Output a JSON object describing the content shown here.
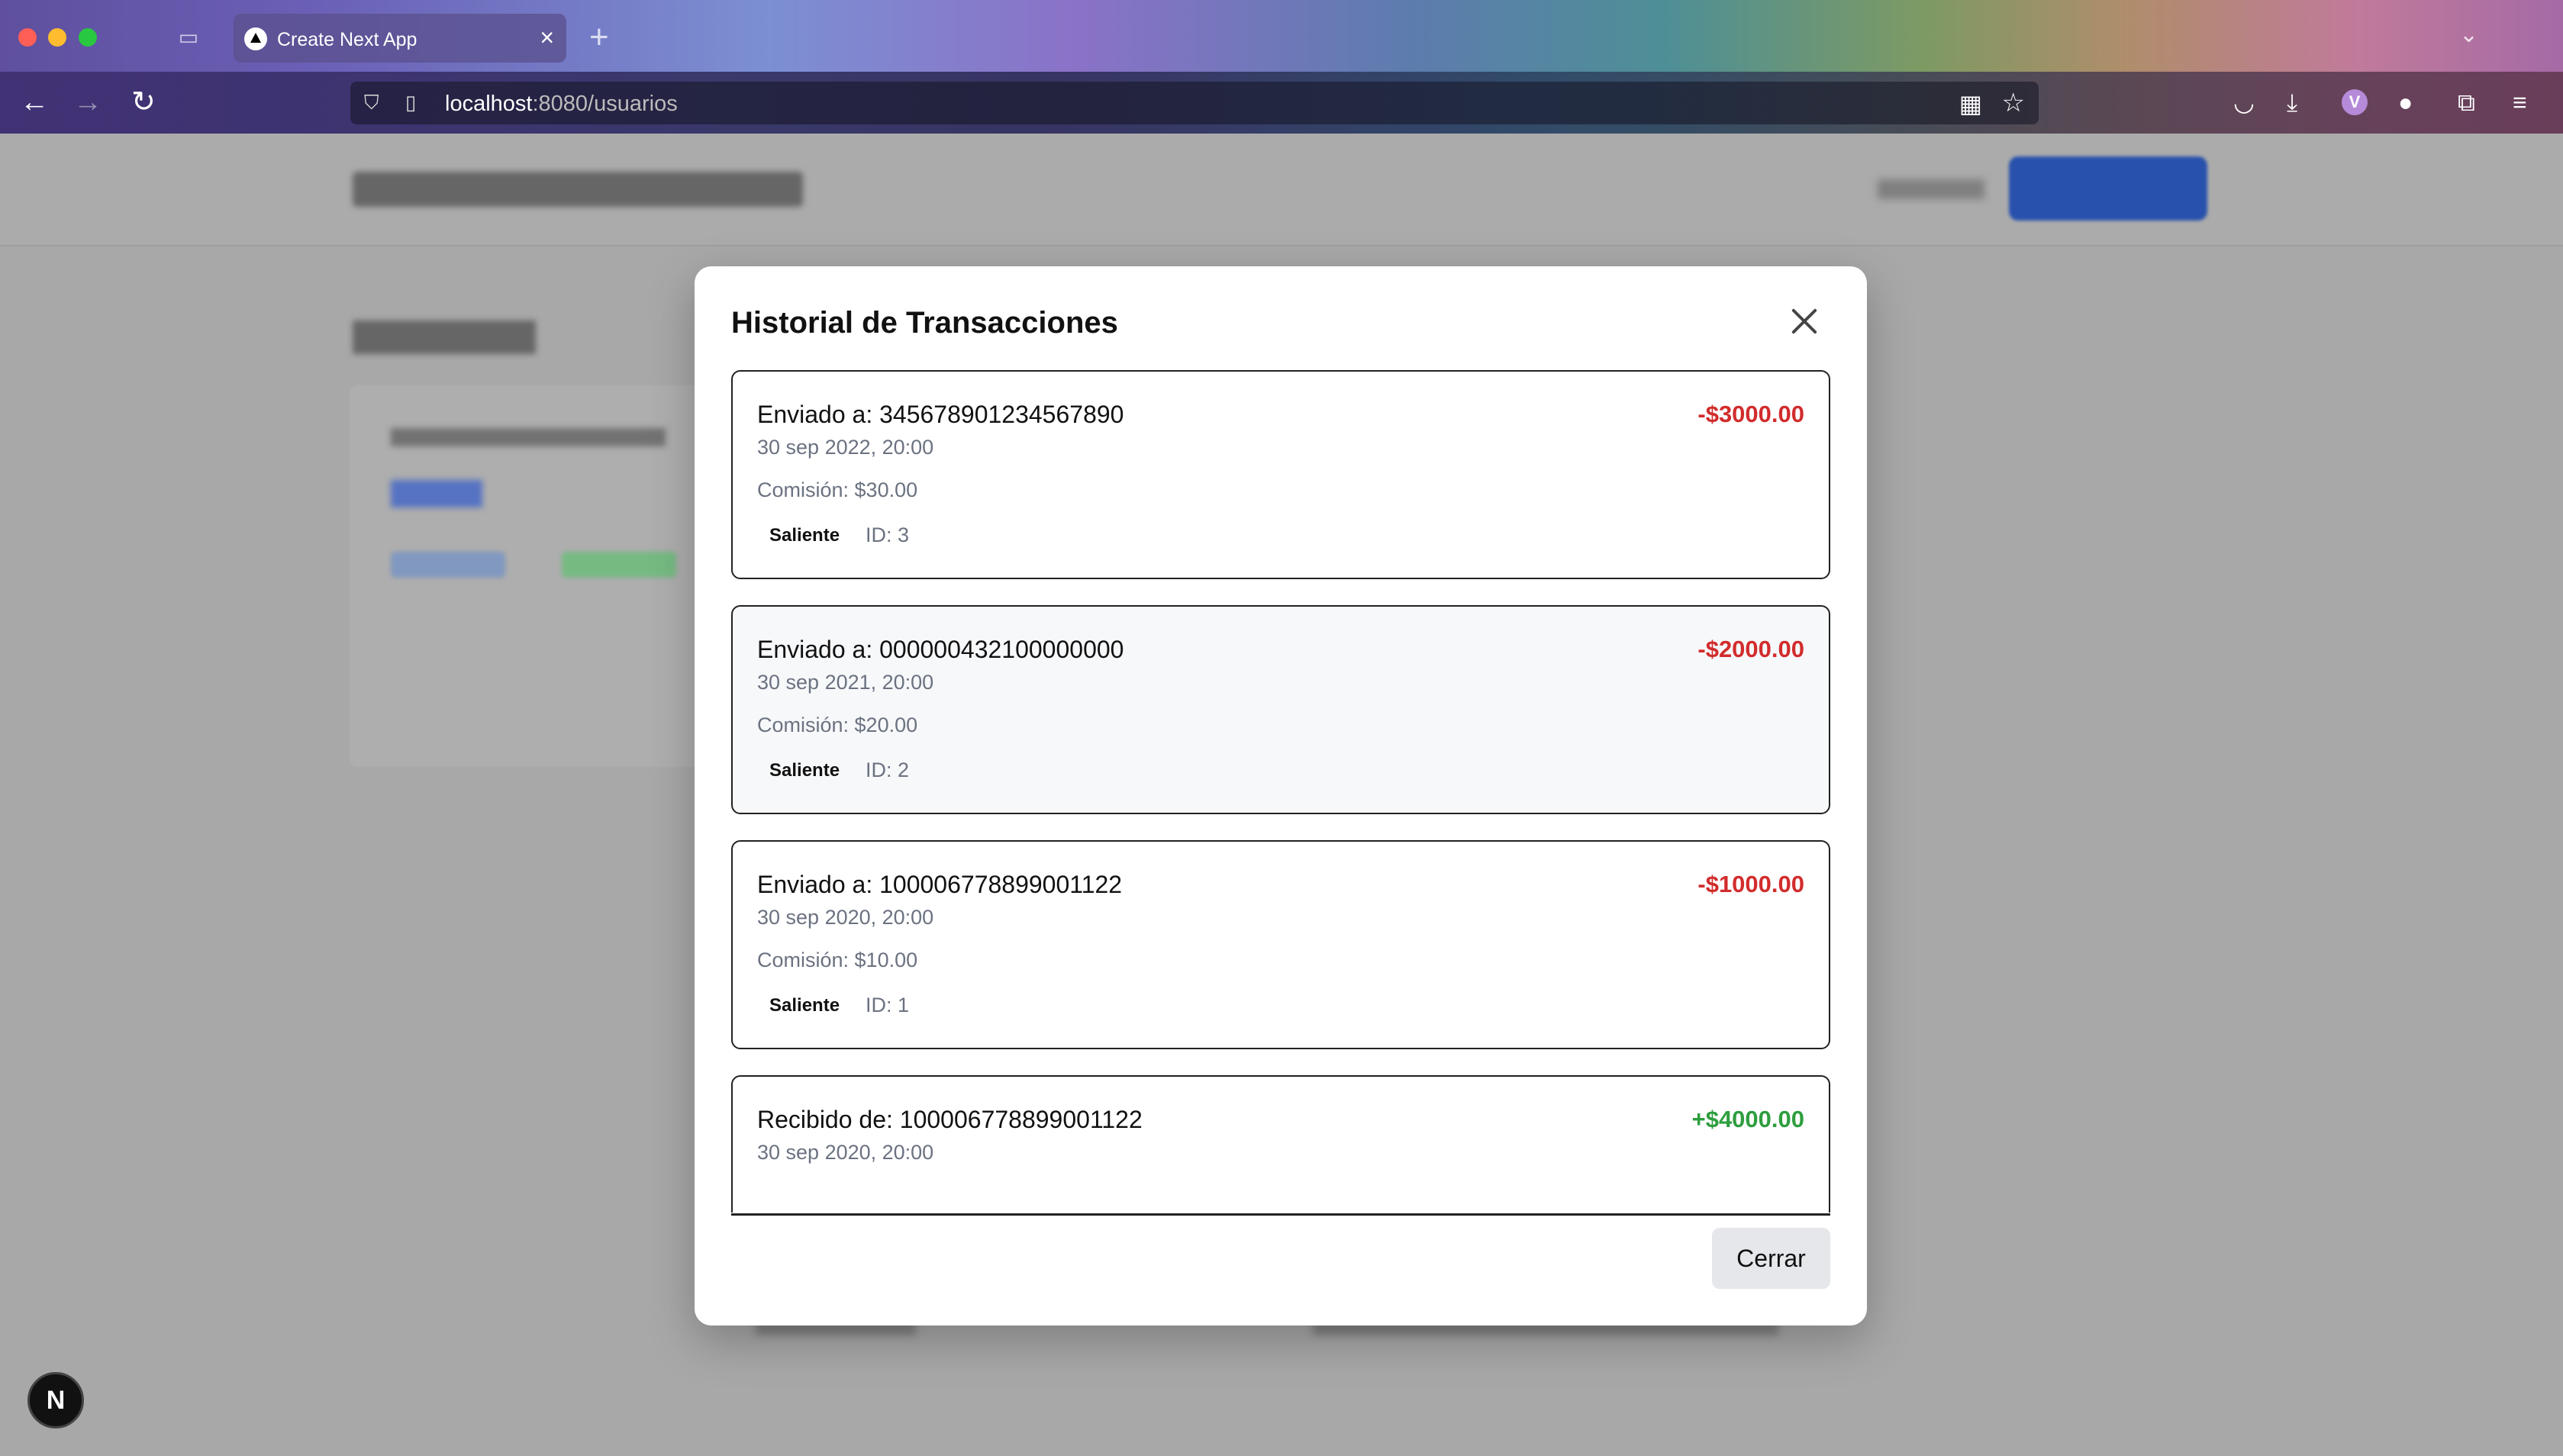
{
  "browser": {
    "tab_title": "Create Next App",
    "url_host": "localhost",
    "url_rest": ":8080/usuarios",
    "tab_close_glyph": "×",
    "new_tab_glyph": "+",
    "avatar_letter": "V"
  },
  "icons": {
    "back": "←",
    "forward": "→",
    "reload": "↻",
    "shield": "⛉",
    "page": "▯",
    "qr": "▦",
    "star": "☆",
    "pocket": "◡",
    "download": "⤓",
    "extensions": "⧉",
    "menu": "≡",
    "chevron_down": "⌄",
    "tab_overview": "▭"
  },
  "modal": {
    "title": "Historial de Transacciones",
    "close_button": "Cerrar",
    "transactions": [
      {
        "party": "Enviado a: 345678901234567890",
        "date": "30 sep 2022, 20:00",
        "fee": "Comisión: $30.00",
        "type": "Saliente",
        "id": "ID: 3",
        "amount": "-$3000.00",
        "direction": "out"
      },
      {
        "party": "Enviado a: 000000432100000000",
        "date": "30 sep 2021, 20:00",
        "fee": "Comisión: $20.00",
        "type": "Saliente",
        "id": "ID: 2",
        "amount": "-$2000.00",
        "direction": "out"
      },
      {
        "party": "Enviado a: 100006778899001122",
        "date": "30 sep 2020, 20:00",
        "fee": "Comisión: $10.00",
        "type": "Saliente",
        "id": "ID: 1",
        "amount": "-$1000.00",
        "direction": "out"
      },
      {
        "party": "Recibido de: 100006778899001122",
        "date": "30 sep 2020, 20:00",
        "amount": "+$4000.00",
        "direction": "in"
      }
    ]
  },
  "next_badge": "N",
  "colors": {
    "outgoing": "#d22c2c",
    "incoming": "#2e9e3e"
  }
}
